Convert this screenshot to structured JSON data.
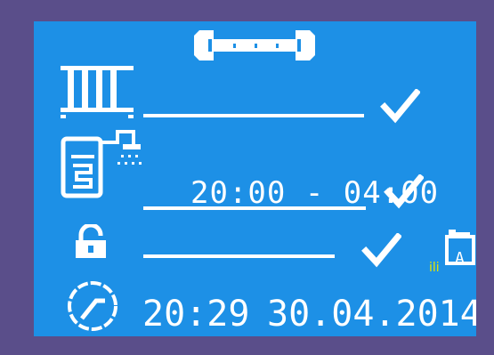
{
  "display": {
    "hot_water_schedule": "20:00 - 04:00",
    "clock_time": "20:29",
    "clock_date": "30.04.2014.",
    "or_label": "ili",
    "auto_letter": "A"
  },
  "icons": {
    "service": "wrench-icon",
    "heating": "radiator-icon",
    "hot_water": "boiler-shower-icon",
    "lock": "padlock-icon",
    "clock": "clock-icon",
    "auto_mode": "auto-container-icon",
    "status": "checkmark-icon"
  },
  "colors": {
    "frame": "#5a4e8a",
    "screen": "#1d90e6",
    "foreground": "#ffffff",
    "highlight": "#e6e600"
  }
}
